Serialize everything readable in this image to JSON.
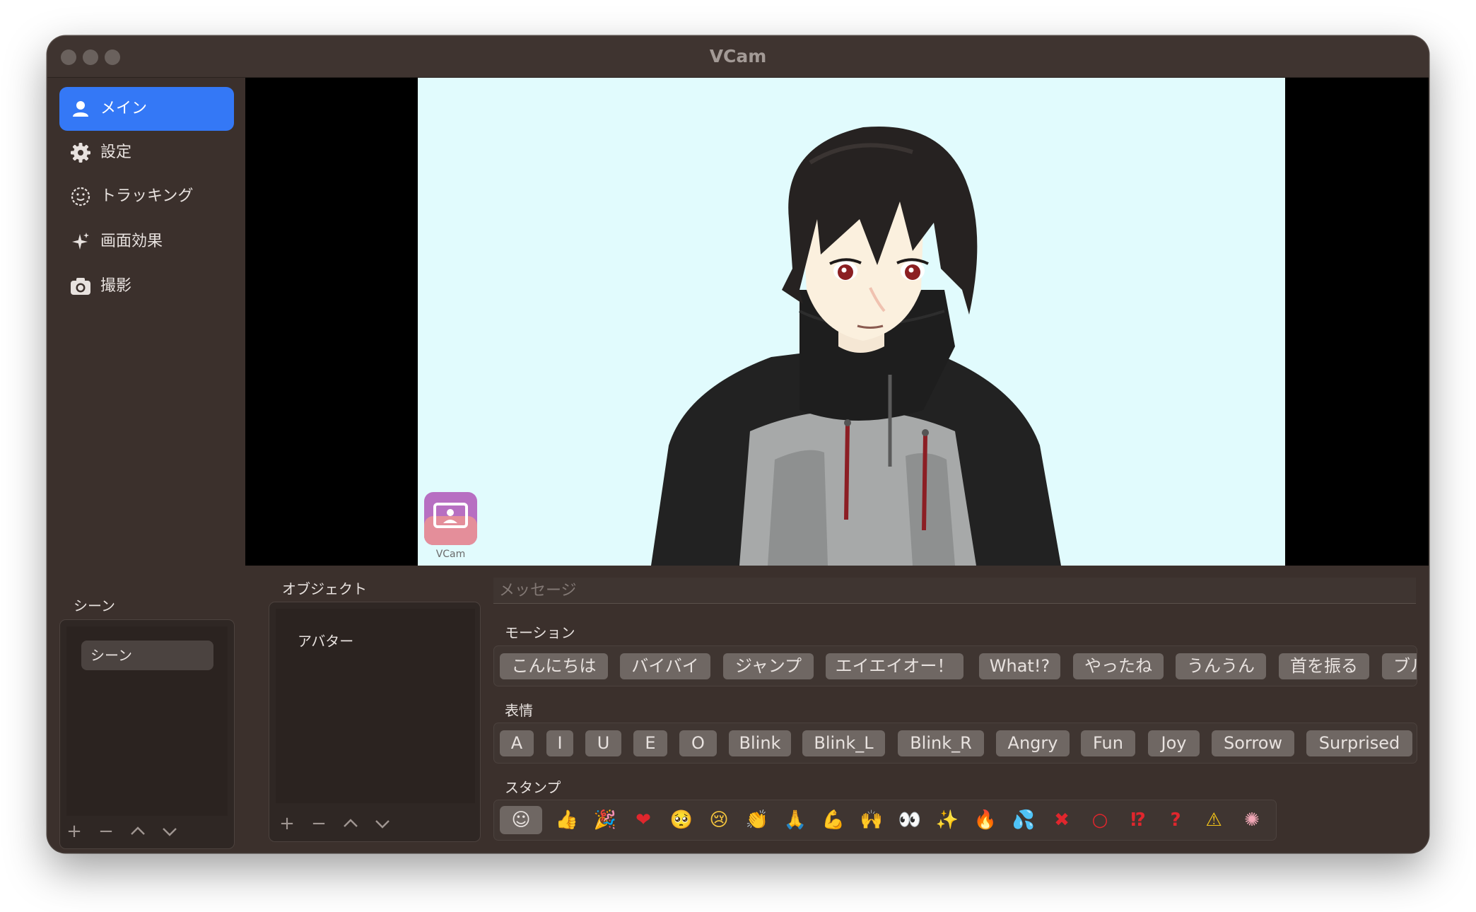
{
  "window": {
    "title": "VCam"
  },
  "sidebar": {
    "items": [
      {
        "label": "メイン",
        "icon": "person-icon",
        "active": true
      },
      {
        "label": "設定",
        "icon": "gear-icon"
      },
      {
        "label": "トラッキング",
        "icon": "smiley-face-icon"
      },
      {
        "label": "画面効果",
        "icon": "sparkles-icon"
      },
      {
        "label": "撮影",
        "icon": "camera-icon"
      }
    ]
  },
  "scene": {
    "title": "シーン",
    "items": [
      "シーン"
    ],
    "controls": [
      "+",
      "−",
      "^",
      "v"
    ]
  },
  "objects": {
    "title": "オブジェクト",
    "items": [
      "アバター"
    ],
    "controls": [
      "+",
      "−",
      "^",
      "v"
    ]
  },
  "preview": {
    "watermark_label": "VCam"
  },
  "message": {
    "placeholder": "メッセージ"
  },
  "motion": {
    "title": "モーション",
    "buttons": [
      "こんにちは",
      "バイバイ",
      "ジャンプ",
      "エイエイオー！",
      "What!?",
      "やったね",
      "うんうん",
      "首を振る",
      "ブル"
    ]
  },
  "expression": {
    "title": "表情",
    "buttons": [
      "A",
      "I",
      "U",
      "E",
      "O",
      "Blink",
      "Blink_L",
      "Blink_R",
      "Angry",
      "Fun",
      "Joy",
      "Sorrow",
      "Surprised"
    ]
  },
  "stamps": {
    "title": "スタンプ",
    "items": [
      {
        "name": "smiley-face-icon",
        "glyph": "☺"
      },
      {
        "name": "thumbs-up-icon",
        "glyph": "👍"
      },
      {
        "name": "party-popper-icon",
        "glyph": "🎉"
      },
      {
        "name": "heart-icon",
        "glyph": "❤"
      },
      {
        "name": "pleading-face-icon",
        "glyph": "🥺"
      },
      {
        "name": "crying-face-icon",
        "glyph": "😢"
      },
      {
        "name": "clapping-hands-icon",
        "glyph": "👏"
      },
      {
        "name": "folded-hands-icon",
        "glyph": "🙏"
      },
      {
        "name": "flexed-biceps-icon",
        "glyph": "💪"
      },
      {
        "name": "raising-hands-icon",
        "glyph": "🙌"
      },
      {
        "name": "eyes-icon",
        "glyph": "👀"
      },
      {
        "name": "sparkles-icon",
        "glyph": "✨"
      },
      {
        "name": "fire-icon",
        "glyph": "🔥"
      },
      {
        "name": "sweat-droplets-icon",
        "glyph": "💦"
      },
      {
        "name": "cross-mark-icon",
        "glyph": "✖"
      },
      {
        "name": "circle-icon",
        "glyph": "○"
      },
      {
        "name": "exclamation-question-icon",
        "glyph": "⁉"
      },
      {
        "name": "question-mark-icon",
        "glyph": "?"
      },
      {
        "name": "warning-icon",
        "glyph": "⚠"
      },
      {
        "name": "wow-burst-icon",
        "glyph": "✺"
      }
    ]
  },
  "colors": {
    "accent": "#3478f6",
    "stage_bg": "#e1fbfd",
    "window_bg": "#3b302c"
  }
}
